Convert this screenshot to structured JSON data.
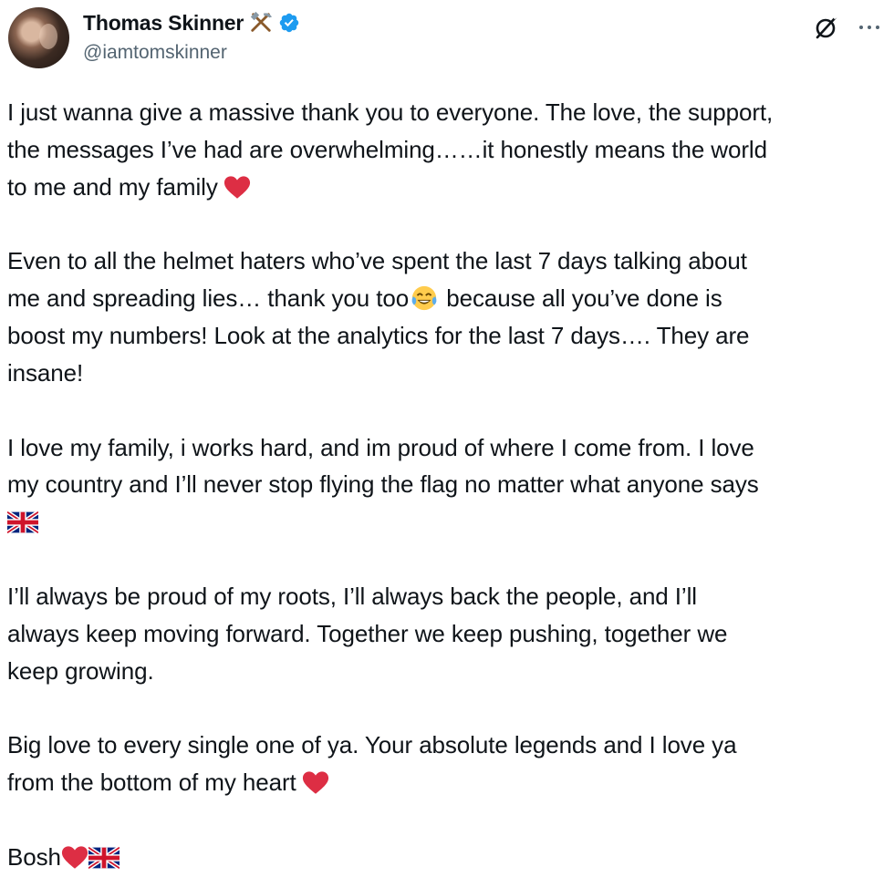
{
  "tweet": {
    "author": {
      "name": "Thomas Skinner",
      "handle": "@iamtomskinner",
      "name_emoji_icon": "hammer-and-pick-icon",
      "verified_icon": "verified-badge-icon",
      "verified_color": "#1d9bf0"
    },
    "actions": {
      "grok_icon": "grok-icon",
      "more_icon": "more-options-icon"
    },
    "paragraphs": [
      {
        "lines": [
          "I just wanna give a massive thank you to everyone. The love, the support,",
          "the messages I’ve had are overwhelming……it honestly means the world",
          "to me and my family"
        ]
      },
      {
        "lines": [
          "Even to all the helmet haters who’ve spent the last 7 days talking about",
          "me and spreading lies… thank you too",
          " because all you’ve done is",
          "boost my numbers! Look at the analytics for the last 7 days…. They are",
          "insane!"
        ]
      },
      {
        "lines": [
          "I love my family, i works hard, and im proud of where I come from. I love",
          "my country and I’ll never stop flying the flag no matter what anyone says"
        ]
      },
      {
        "lines": [
          "I’ll always be proud of my roots, I’ll always back the people, and I’ll",
          "always keep moving forward. Together we keep pushing, together we",
          "keep growing."
        ]
      },
      {
        "lines": [
          "Big love to every single one of ya. Your absolute legends and I love ya",
          "from the bottom of my heart"
        ]
      },
      {
        "lines": [
          "Bosh"
        ]
      }
    ],
    "emoji_icons": {
      "heart": "red-heart-icon",
      "laugh": "tears-of-joy-icon",
      "flag": "uk-flag-icon"
    },
    "colors": {
      "text": "#0f1419",
      "secondary_text": "#536471",
      "heart": "#e0245e"
    }
  }
}
